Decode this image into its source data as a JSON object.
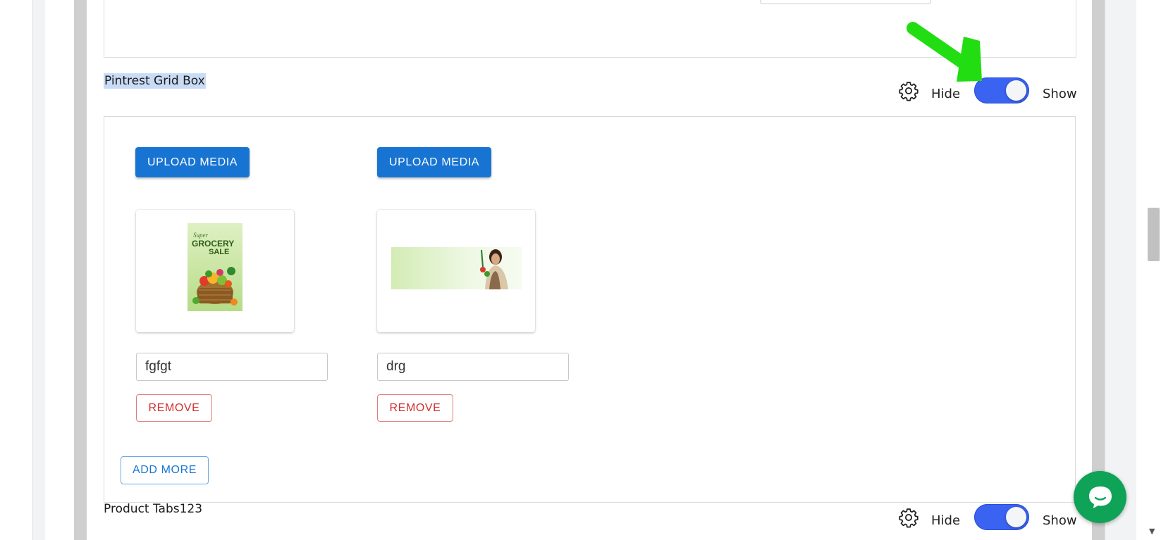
{
  "colors": {
    "accent": "#1874d2",
    "toggle_on": "#3a63f2",
    "remove": "#d32f2f",
    "chat": "#0ea357",
    "annotation": "#22dd11",
    "title_highlight": "#c9dcf6"
  },
  "sections": {
    "pintrest": {
      "title": "Pintrest Grid Box",
      "hide_label": "Hide",
      "show_label": "Show",
      "toggle_on": true,
      "items": [
        {
          "upload_label": "UPLOAD MEDIA",
          "image_icon": "grocery-sale-image",
          "image_text_top": "Super",
          "image_text_mid": "GROCERY",
          "image_text_bot": "SALE",
          "caption": "fgfgt",
          "remove_label": "REMOVE"
        },
        {
          "upload_label": "UPLOAD MEDIA",
          "image_icon": "woman-with-vegetables-banner",
          "caption": "drg",
          "remove_label": "REMOVE"
        }
      ],
      "add_more_label": "ADD MORE"
    },
    "product_tabs": {
      "title": "Product Tabs123",
      "hide_label": "Hide",
      "show_label": "Show",
      "toggle_on": true
    }
  },
  "icons": {
    "settings": "gear-icon",
    "chat": "chat-bubble-icon",
    "annotation": "green-arrow-annotation",
    "scroll_down": "▼"
  }
}
